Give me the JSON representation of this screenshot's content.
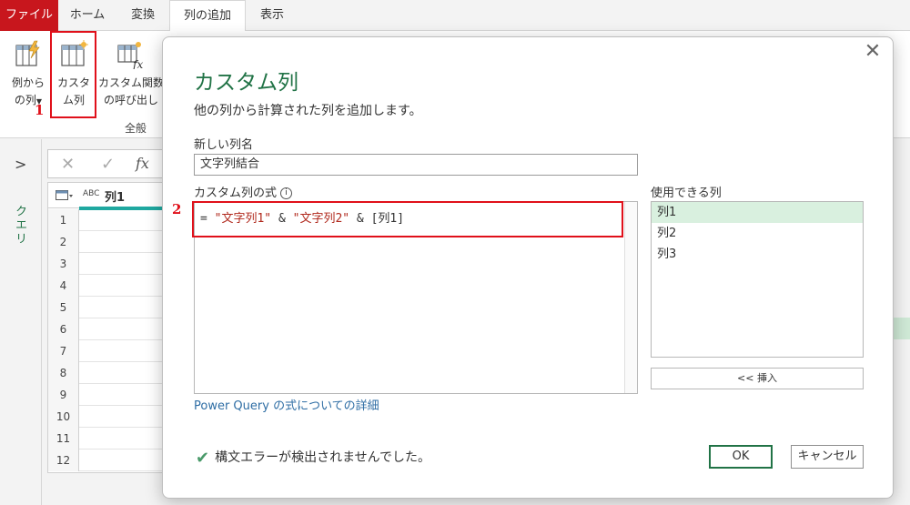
{
  "ribbon": {
    "tabs": [
      {
        "label": "ファイル"
      },
      {
        "label": "ホーム"
      },
      {
        "label": "変換"
      },
      {
        "label": "列の追加"
      },
      {
        "label": "表示"
      }
    ],
    "buttons": {
      "example_line1": "例から",
      "example_line2": "の列",
      "custom_line1": "カスタ",
      "custom_line2": "ム列",
      "invoke_line1": "カスタム関数",
      "invoke_line2": "の呼び出し"
    },
    "group_label": "全般",
    "step1": "1"
  },
  "left_pane": {
    "queries_label": "クエリ"
  },
  "grid": {
    "column_type": "ABC",
    "column_name": "列1",
    "rows": [
      "1",
      "2",
      "3",
      "4",
      "5",
      "6",
      "7",
      "8",
      "9",
      "10",
      "11",
      "12"
    ]
  },
  "dialog": {
    "title": "カスタム列",
    "subtitle": "他の列から計算された列を追加します。",
    "new_column_label": "新しい列名",
    "new_column_value": "文字列結合",
    "formula_label": "カスタム列の式",
    "formula": {
      "p1": "= ",
      "p2": "\"文字列1\"",
      "p3": " & ",
      "p4": "\"文字列2\"",
      "p5": " & [列1]"
    },
    "step2": "2",
    "available_label": "使用できる列",
    "available_columns": [
      "列1",
      "列2",
      "列3"
    ],
    "insert_button": "<< 挿入",
    "learn_link": "Power Query の式についての詳細",
    "status": "構文エラーが検出されませんでした。",
    "ok_button": "OK",
    "cancel_button": "キャンセル"
  },
  "colors": {
    "file_tab": "#c8161d",
    "accent_green": "#217346",
    "highlight_red": "#e0101a",
    "selected_row": "#d9f0df"
  }
}
